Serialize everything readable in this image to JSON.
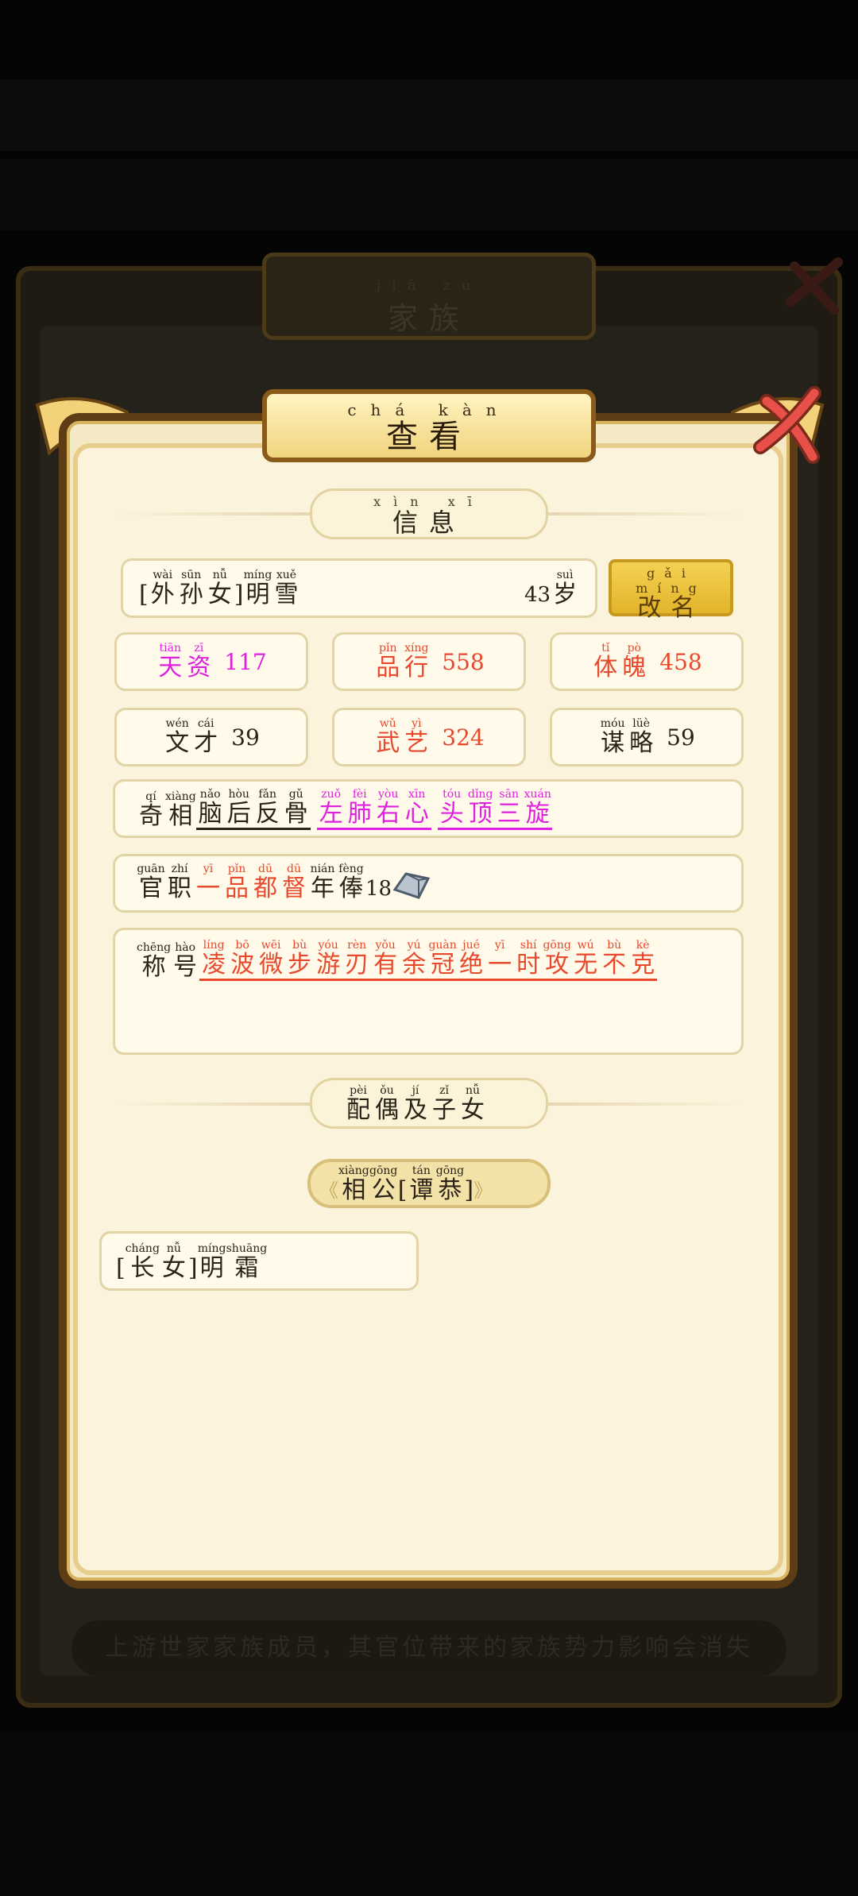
{
  "background": {
    "family_title_pinyin": "jiā zú",
    "family_title": "家族",
    "footer_note": "上游世家家族成员，其官位带来的家族势力影响会消失"
  },
  "dialog": {
    "title_pinyin": "chá kàn",
    "title": "查看",
    "close_icon": "close-x-icon"
  },
  "info_section": {
    "header_pinyin": "xìn xī",
    "header": "信息",
    "name": {
      "prefix_chars": [
        {
          "p": "wài",
          "h": "外"
        },
        {
          "p": "sūn",
          "h": "孙"
        },
        {
          "p": "nǚ",
          "h": "女"
        }
      ],
      "name_chars": [
        {
          "p": "míng",
          "h": "明"
        },
        {
          "p": "xuě",
          "h": "雪"
        }
      ],
      "age_num": "43",
      "age_unit_pinyin": "suì",
      "age_unit": "岁"
    },
    "rename_button": {
      "pinyin": "gǎi míng",
      "label": "改名"
    }
  },
  "stats": [
    {
      "chars": [
        {
          "p": "tiān",
          "h": "天"
        },
        {
          "p": "zī",
          "h": "资"
        }
      ],
      "value": "117",
      "color": "#e020e0"
    },
    {
      "chars": [
        {
          "p": "pǐn",
          "h": "品"
        },
        {
          "p": "xíng",
          "h": "行"
        }
      ],
      "value": "558",
      "color": "#e8482c"
    },
    {
      "chars": [
        {
          "p": "tǐ",
          "h": "体"
        },
        {
          "p": "pò",
          "h": "魄"
        }
      ],
      "value": "458",
      "color": "#e8482c"
    },
    {
      "chars": [
        {
          "p": "wén",
          "h": "文"
        },
        {
          "p": "cái",
          "h": "才"
        }
      ],
      "value": "39",
      "color": "#2a2317"
    },
    {
      "chars": [
        {
          "p": "wǔ",
          "h": "武"
        },
        {
          "p": "yì",
          "h": "艺"
        }
      ],
      "value": "324",
      "color": "#e8482c"
    },
    {
      "chars": [
        {
          "p": "móu",
          "h": "谋"
        },
        {
          "p": "lüè",
          "h": "略"
        }
      ],
      "value": "59",
      "color": "#2a2317"
    }
  ],
  "appearance": {
    "label_chars": [
      {
        "p": "qí",
        "h": "奇"
      },
      {
        "p": "xiàng",
        "h": "相"
      }
    ],
    "traits": [
      {
        "chars": [
          {
            "p": "nǎo",
            "h": "脑"
          },
          {
            "p": "hòu",
            "h": "后"
          },
          {
            "p": "fǎn",
            "h": "反"
          },
          {
            "p": "gǔ",
            "h": "骨"
          }
        ],
        "color": "#2a2317"
      },
      {
        "chars": [
          {
            "p": "zuǒ",
            "h": "左"
          },
          {
            "p": "fèi",
            "h": "肺"
          },
          {
            "p": "yòu",
            "h": "右"
          },
          {
            "p": "xīn",
            "h": "心"
          }
        ],
        "color": "#e020e0"
      },
      {
        "chars": [
          {
            "p": "tóu",
            "h": "头"
          },
          {
            "p": "dǐng",
            "h": "顶"
          },
          {
            "p": "sān",
            "h": "三"
          },
          {
            "p": "xuán",
            "h": "旋"
          }
        ],
        "color": "#e020e0"
      }
    ]
  },
  "official": {
    "label_chars": [
      {
        "p": "guān",
        "h": "官"
      },
      {
        "p": "zhí",
        "h": "职"
      }
    ],
    "title_chars": [
      {
        "p": "yī",
        "h": "一"
      },
      {
        "p": "pǐn",
        "h": "品"
      },
      {
        "p": "dū",
        "h": "都"
      },
      {
        "p": "dū",
        "h": "督"
      }
    ],
    "title_color": "#e8482c",
    "salary_chars": [
      {
        "p": "nián",
        "h": "年"
      },
      {
        "p": "fèng",
        "h": "俸"
      }
    ],
    "salary_value": "18",
    "salary_icon": "silver-ingot-icon"
  },
  "honor": {
    "label_chars": [
      {
        "p": "chēng",
        "h": "称"
      },
      {
        "p": "hào",
        "h": "号"
      }
    ],
    "title_chars": [
      {
        "p": "líng",
        "h": "凌"
      },
      {
        "p": "bō",
        "h": "波"
      },
      {
        "p": "wēi",
        "h": "微"
      },
      {
        "p": "bù",
        "h": "步"
      },
      {
        "p": "yóu",
        "h": "游"
      },
      {
        "p": "rèn",
        "h": "刃"
      },
      {
        "p": "yǒu",
        "h": "有"
      },
      {
        "p": "yú",
        "h": "余"
      },
      {
        "p": "guàn",
        "h": "冠"
      },
      {
        "p": "jué",
        "h": "绝"
      },
      {
        "p": "yī",
        "h": "一"
      },
      {
        "p": "shí",
        "h": "时"
      },
      {
        "p": "gōng",
        "h": "攻"
      },
      {
        "p": "wú",
        "h": "无"
      },
      {
        "p": "bù",
        "h": "不"
      },
      {
        "p": "kè",
        "h": "克"
      }
    ],
    "title_color": "#e8482c"
  },
  "spouse_section": {
    "header_chars": [
      {
        "p": "pèi",
        "h": "配"
      },
      {
        "p": "ǒu",
        "h": "偶"
      },
      {
        "p": "jí",
        "h": "及"
      },
      {
        "p": "zǐ",
        "h": "子"
      },
      {
        "p": "nǚ",
        "h": "女"
      }
    ],
    "spouse_role_chars": [
      {
        "p": "xiàng",
        "h": "相"
      },
      {
        "p": "gōng",
        "h": "公"
      }
    ],
    "spouse_name_chars": [
      {
        "p": "tán",
        "h": "谭"
      },
      {
        "p": "gōng",
        "h": "恭"
      }
    ],
    "child": {
      "role_chars": [
        {
          "p": "cháng",
          "h": "长"
        },
        {
          "p": "nǚ",
          "h": "女"
        }
      ],
      "name_chars": [
        {
          "p": "míng",
          "h": "明"
        },
        {
          "p": "shuāng",
          "h": "霜"
        }
      ]
    }
  },
  "colors": {
    "frame": "#5e3d14",
    "paper": "#fbf3dc",
    "magenta": "#e020e0",
    "red": "#e8482c",
    "gold_button": "#e2b52a"
  }
}
